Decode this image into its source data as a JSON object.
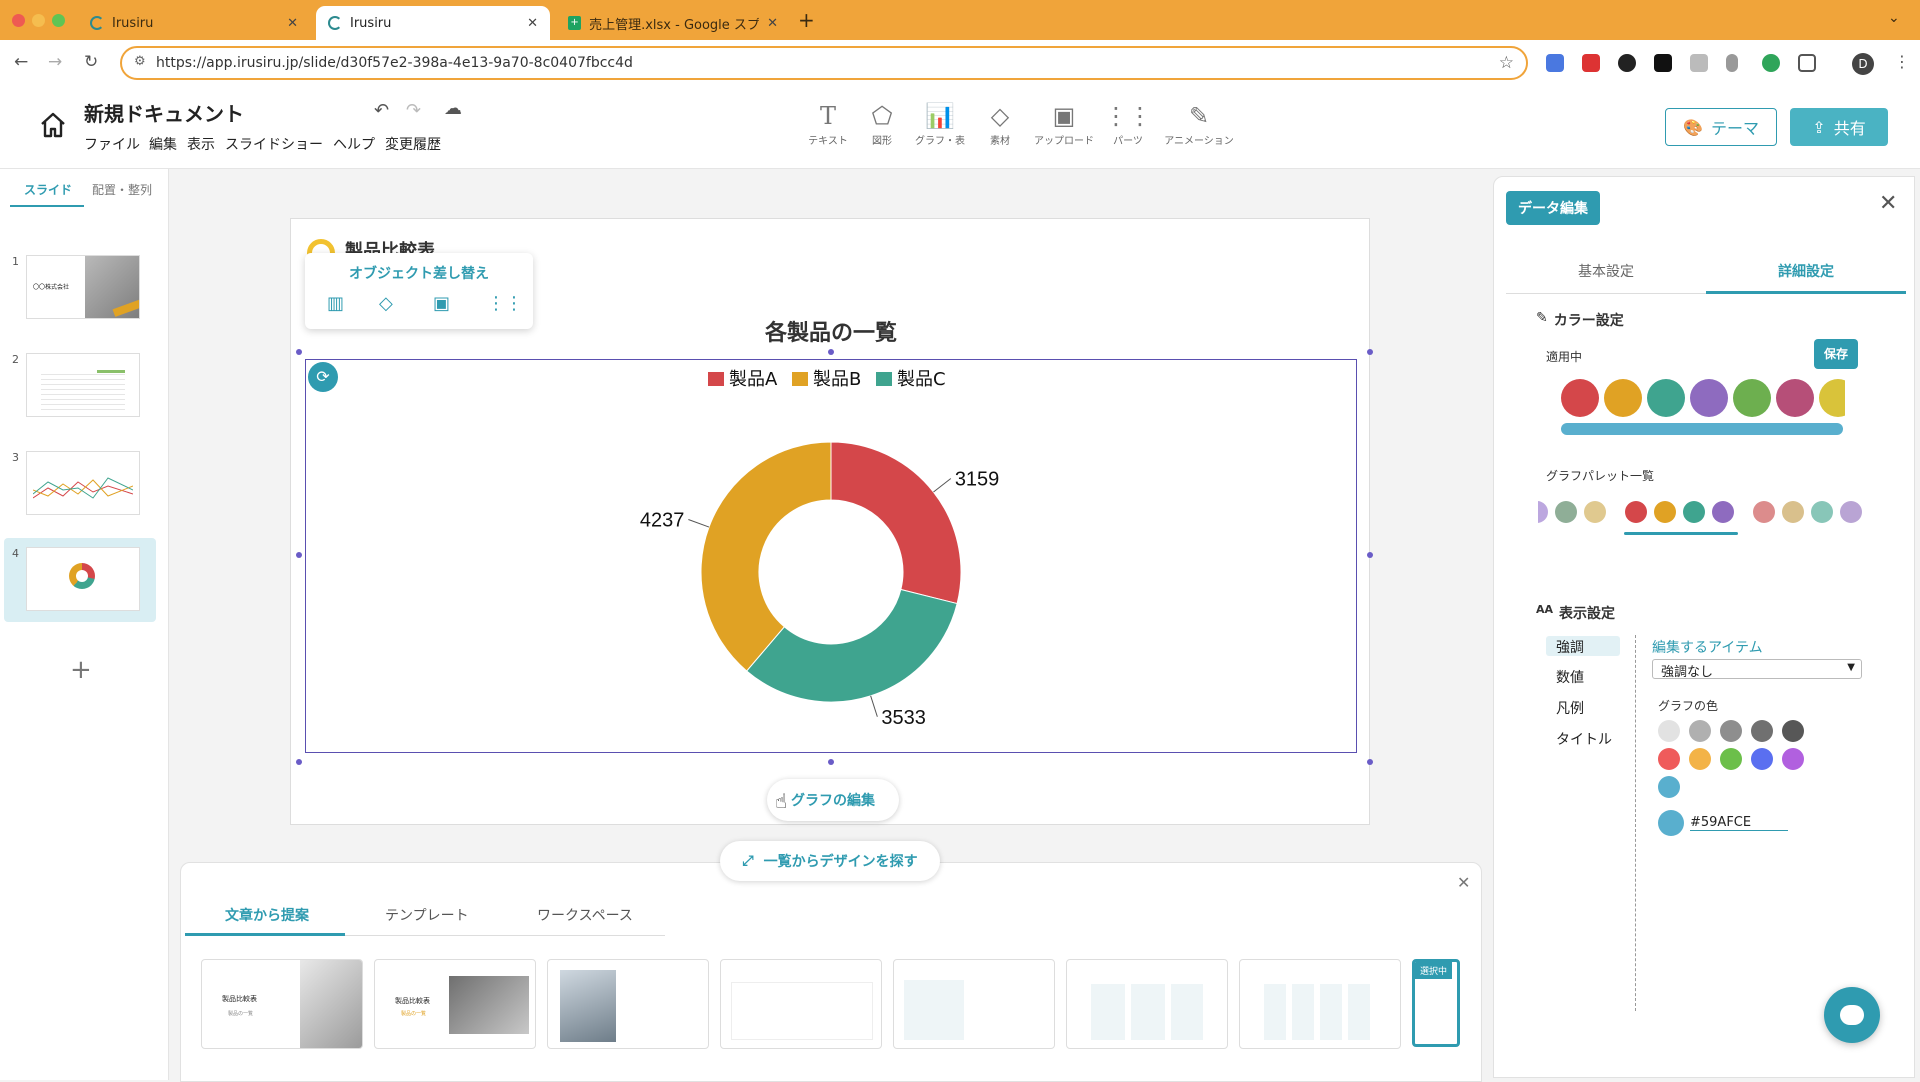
{
  "browser": {
    "tabs": [
      {
        "label": "Irusiru",
        "active": false
      },
      {
        "label": "Irusiru",
        "active": true
      },
      {
        "label": "売上管理.xlsx - Google スプレ",
        "active": false
      }
    ],
    "new_tab": "+",
    "url": "https://app.irusiru.jp/slide/d30f57e2-398a-4e13-9a70-8c0407fbcc4d",
    "profile_initial": "D"
  },
  "app": {
    "doc_title": "新規ドキュメント",
    "menu": [
      "ファイル",
      "編集",
      "表示",
      "スライドショー",
      "ヘルプ",
      "変更履歴"
    ],
    "tools": [
      {
        "icon": "text-icon",
        "label": "テキスト"
      },
      {
        "icon": "shape-icon",
        "label": "図形"
      },
      {
        "icon": "chart-icon",
        "label": "グラフ・表"
      },
      {
        "icon": "material-icon",
        "label": "素材"
      },
      {
        "icon": "upload-icon",
        "label": "アップロード"
      },
      {
        "icon": "parts-icon",
        "label": "パーツ"
      },
      {
        "icon": "animation-icon",
        "label": "アニメーション"
      }
    ],
    "theme_button": "テーマ",
    "share_button": "共有"
  },
  "left_panel": {
    "tabs": [
      "スライド",
      "配置・整列"
    ],
    "slide_numbers": [
      "1",
      "2",
      "3",
      "4"
    ],
    "thumb1_text": "〇〇株式会社",
    "add": "+"
  },
  "slide": {
    "header_title": "製品比較表",
    "replace_popup_title": "オブジェクト差し替え",
    "chart_title": "各製品の一覧",
    "edit_chart_button": "グラフの編集"
  },
  "chart_data": {
    "type": "pie",
    "title": "各製品の一覧",
    "donut": true,
    "legend_position": "top",
    "categories": [
      "製品A",
      "製品C",
      "製品B"
    ],
    "values": [
      3159,
      3533,
      4237
    ],
    "colors": [
      "#d4474a",
      "#3fa48f",
      "#e0a224"
    ],
    "legend": [
      {
        "name": "製品A",
        "color": "#d4474a"
      },
      {
        "name": "製品B",
        "color": "#e0a224"
      },
      {
        "name": "製品C",
        "color": "#3fa48f"
      }
    ]
  },
  "bottom_panel": {
    "find_design": "一覧からデザインを探す",
    "tabs": [
      "文章から提案",
      "テンプレート",
      "ワークスペース"
    ],
    "template_texts": {
      "t1_title": "製品比較表",
      "t1_sub": "製品の一覧",
      "t2_title": "製品比較表",
      "t2_sub": "製品の一覧"
    },
    "selected_label": "選択中"
  },
  "right_panel": {
    "data_edit": "データ編集",
    "tabs": [
      "基本設定",
      "詳細設定"
    ],
    "color_settings": "カラー設定",
    "applied": "適用中",
    "save": "保存",
    "applied_colors": [
      "#d4474a",
      "#e0a224",
      "#3fa48f",
      "#8e6bbf",
      "#6daf4f",
      "#b64f78",
      "#d9c33a"
    ],
    "palette_list_label": "グラフパレット一覧",
    "palettes": [
      [
        "#bca7df",
        "#8fae97",
        "#e0c98f"
      ],
      [
        "#d4474a",
        "#e0a224",
        "#3fa48f",
        "#8e6bbf"
      ],
      [
        "#dc8c8c",
        "#d9c08c",
        "#88c6b8",
        "#b9a4d4"
      ]
    ],
    "display_settings": "表示設定",
    "display_items": [
      "強調",
      "数値",
      "凡例",
      "タイトル"
    ],
    "edit_item_label": "編集するアイテム",
    "select_value": "強調なし",
    "graph_color_label": "グラフの色",
    "graph_colors": [
      "#e2e2e2",
      "#b0b0b0",
      "#8e8e8e",
      "#707070",
      "#575757",
      "#ef5b5b",
      "#f3b347",
      "#6cbf4a",
      "#5a6ff0",
      "#b160df",
      "#59afce"
    ],
    "hex_value": "#59AFCE",
    "hex_color": "#59afce"
  }
}
